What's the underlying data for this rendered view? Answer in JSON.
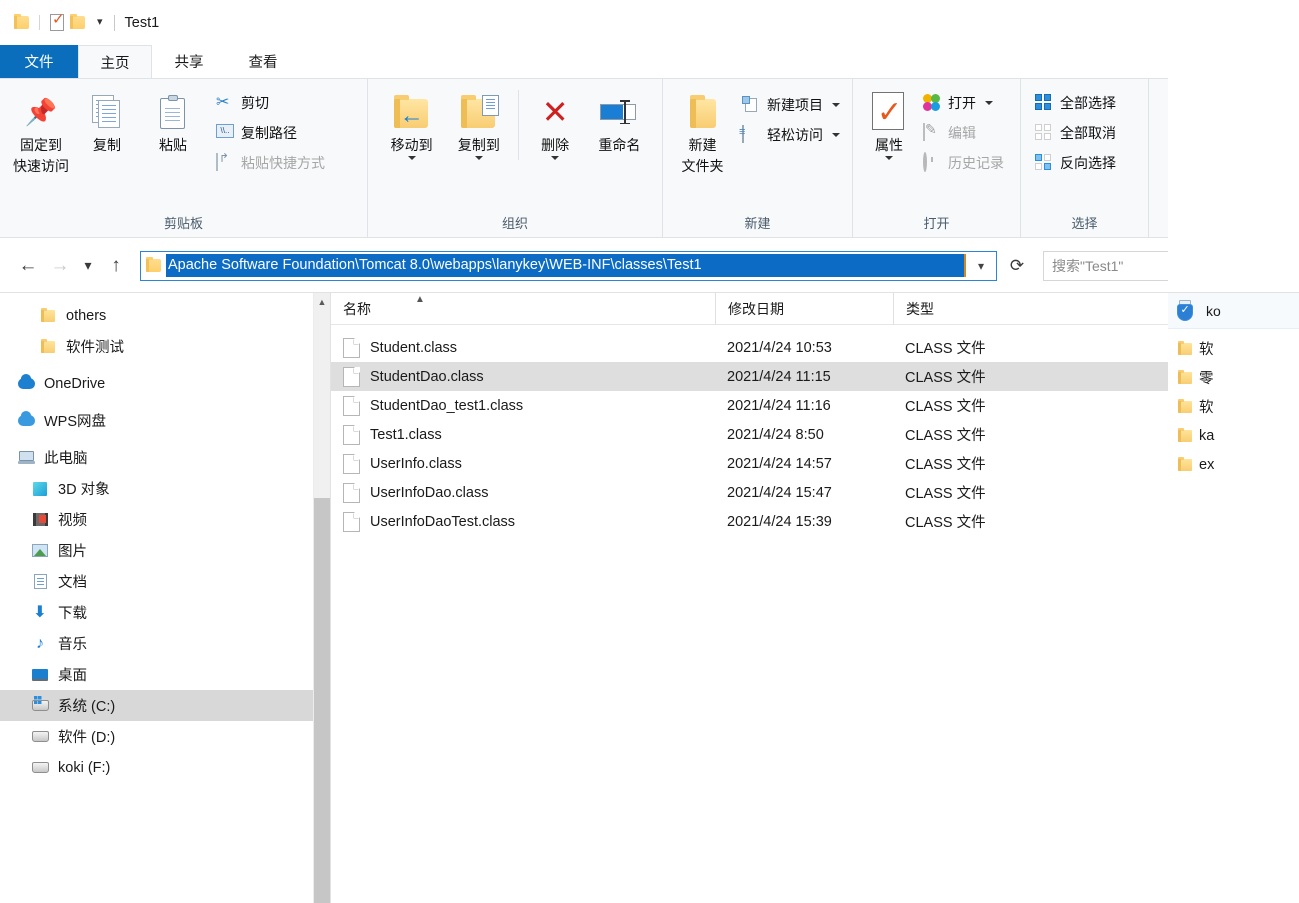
{
  "window": {
    "title": "Test1",
    "quick_access": {
      "folder_icon": "folder-icon",
      "properties_icon": "properties-checkmark-icon",
      "new_folder_icon": "new-folder-icon",
      "dropdown_icon": "chevron-down-icon"
    },
    "controls": {
      "minimize_label": "—"
    }
  },
  "ribbon": {
    "tabs": [
      {
        "id": "file",
        "label": "文件"
      },
      {
        "id": "home",
        "label": "主页"
      },
      {
        "id": "share",
        "label": "共享"
      },
      {
        "id": "view",
        "label": "查看"
      }
    ],
    "groups": [
      {
        "id": "clipboard",
        "title": "剪贴板",
        "big_buttons": [
          {
            "id": "pin-to-quick-access",
            "label_line1": "固定到",
            "label_line2": "快速访问",
            "icon": "pin-icon"
          },
          {
            "id": "copy",
            "label_line1": "复制",
            "label_line2": "",
            "icon": "copy-icon"
          },
          {
            "id": "paste",
            "label_line1": "粘贴",
            "label_line2": "",
            "icon": "clipboard-icon"
          }
        ],
        "small_buttons": [
          {
            "id": "cut",
            "label": "剪切",
            "icon": "scissors-icon",
            "dim": false
          },
          {
            "id": "copy-path",
            "label": "复制路径",
            "icon": "copy-path-icon",
            "dim": false
          },
          {
            "id": "paste-shortcut",
            "label": "粘贴快捷方式",
            "icon": "paste-shortcut-icon",
            "dim": true
          }
        ]
      },
      {
        "id": "organize",
        "title": "组织",
        "big_buttons": [
          {
            "id": "move-to",
            "label_line1": "移动到",
            "label_line2": "",
            "icon": "move-to-icon",
            "caret": true
          },
          {
            "id": "copy-to",
            "label_line1": "复制到",
            "label_line2": "",
            "icon": "copy-to-icon",
            "caret": true
          },
          {
            "id": "delete",
            "label_line1": "删除",
            "label_line2": "",
            "icon": "delete-x-icon",
            "caret": true
          },
          {
            "id": "rename",
            "label_line1": "重命名",
            "label_line2": "",
            "icon": "rename-icon",
            "caret": false
          }
        ]
      },
      {
        "id": "new",
        "title": "新建",
        "big_buttons": [
          {
            "id": "new-folder",
            "label_line1": "新建",
            "label_line2": "文件夹",
            "icon": "new-folder-icon"
          }
        ],
        "small_buttons": [
          {
            "id": "new-item",
            "label": "新建项目",
            "icon": "new-item-icon",
            "caret": true
          },
          {
            "id": "easy-access",
            "label": "轻松访问",
            "icon": "easy-access-icon",
            "caret": true
          }
        ]
      },
      {
        "id": "open",
        "title": "打开",
        "big_buttons": [
          {
            "id": "properties",
            "label_line1": "属性",
            "label_line2": "",
            "icon": "properties-icon",
            "caret": true
          }
        ],
        "small_buttons": [
          {
            "id": "open",
            "label": "打开",
            "icon": "open-clover-icon",
            "caret": true,
            "dim": false
          },
          {
            "id": "edit",
            "label": "编辑",
            "icon": "edit-icon",
            "dim": true
          },
          {
            "id": "history",
            "label": "历史记录",
            "icon": "history-icon",
            "dim": true
          }
        ]
      },
      {
        "id": "select",
        "title": "选择",
        "small_buttons": [
          {
            "id": "select-all",
            "label": "全部选择",
            "icon": "select-all-icon",
            "variant": "full"
          },
          {
            "id": "select-none",
            "label": "全部取消",
            "icon": "select-none-icon",
            "variant": "empty"
          },
          {
            "id": "invert-selection",
            "label": "反向选择",
            "icon": "invert-selection-icon",
            "variant": "mixed"
          }
        ]
      }
    ]
  },
  "address_bar": {
    "back_icon": "arrow-left-icon",
    "forward_icon": "arrow-right-icon",
    "recent_icon": "chevron-down-icon",
    "up_icon": "arrow-up-icon",
    "path_value": "Apache Software Foundation\\Tomcat 8.0\\webapps\\lanykey\\WEB-INF\\classes\\Test1",
    "dropdown_icon": "chevron-down-icon",
    "refresh_icon": "refresh-icon",
    "search_placeholder": "搜索\"Test1\""
  },
  "nav_pane": {
    "items": [
      {
        "id": "others",
        "label": "others",
        "icon": "folder-icon",
        "indent": 1,
        "selected": false
      },
      {
        "id": "software-test",
        "label": "软件测试",
        "icon": "folder-icon",
        "indent": 1,
        "selected": false
      },
      {
        "id": "onedrive",
        "label": "OneDrive",
        "icon": "cloud-icon",
        "indent": 0,
        "selected": false
      },
      {
        "id": "wps-cloud",
        "label": "WPS网盘",
        "icon": "wps-cloud-icon",
        "indent": 0,
        "selected": false
      },
      {
        "id": "this-pc",
        "label": "此电脑",
        "icon": "computer-icon",
        "indent": 0,
        "selected": false
      },
      {
        "id": "3d-objects",
        "label": "3D 对象",
        "icon": "cube-icon",
        "indent": 1,
        "selected": false
      },
      {
        "id": "videos",
        "label": "视频",
        "icon": "video-icon",
        "indent": 1,
        "selected": false
      },
      {
        "id": "pictures",
        "label": "图片",
        "icon": "picture-icon",
        "indent": 1,
        "selected": false
      },
      {
        "id": "documents",
        "label": "文档",
        "icon": "document-icon",
        "indent": 1,
        "selected": false
      },
      {
        "id": "downloads",
        "label": "下载",
        "icon": "download-icon",
        "indent": 1,
        "selected": false
      },
      {
        "id": "music",
        "label": "音乐",
        "icon": "music-icon",
        "indent": 1,
        "selected": false
      },
      {
        "id": "desktop",
        "label": "桌面",
        "icon": "desktop-icon",
        "indent": 1,
        "selected": false
      },
      {
        "id": "drive-c",
        "label": "系统 (C:)",
        "icon": "system-drive-icon",
        "indent": 1,
        "selected": true
      },
      {
        "id": "drive-d",
        "label": "软件 (D:)",
        "icon": "drive-icon",
        "indent": 1,
        "selected": false
      },
      {
        "id": "drive-f",
        "label": "koki (F:)",
        "icon": "drive-icon",
        "indent": 1,
        "selected": false
      }
    ]
  },
  "file_list": {
    "columns": [
      {
        "id": "name",
        "label": "名称",
        "sorted": true,
        "sort_icon": "caret-up-icon"
      },
      {
        "id": "date",
        "label": "修改日期",
        "sorted": false
      },
      {
        "id": "type",
        "label": "类型",
        "sorted": false
      }
    ],
    "rows": [
      {
        "name": "Student.class",
        "date": "2021/4/24 10:53",
        "type": "CLASS 文件",
        "selected": false
      },
      {
        "name": "StudentDao.class",
        "date": "2021/4/24 11:15",
        "type": "CLASS 文件",
        "selected": true
      },
      {
        "name": "StudentDao_test1.class",
        "date": "2021/4/24 11:16",
        "type": "CLASS 文件",
        "selected": false
      },
      {
        "name": "Test1.class",
        "date": "2021/4/24 8:50",
        "type": "CLASS 文件",
        "selected": false
      },
      {
        "name": "UserInfo.class",
        "date": "2021/4/24 14:57",
        "type": "CLASS 文件",
        "selected": false
      },
      {
        "name": "UserInfoDao.class",
        "date": "2021/4/24 15:47",
        "type": "CLASS 文件",
        "selected": false
      },
      {
        "name": "UserInfoDaoTest.class",
        "date": "2021/4/24 15:39",
        "type": "CLASS 文件",
        "selected": false
      }
    ],
    "expander_icon": "chevron-right-icon"
  },
  "background_window": {
    "header": {
      "icon": "usb-shield-icon",
      "label": "ko"
    },
    "items": [
      {
        "label": "软",
        "icon": "folder-icon"
      },
      {
        "label": "零",
        "icon": "folder-icon"
      },
      {
        "label": "软",
        "icon": "folder-icon"
      },
      {
        "label": "ka",
        "icon": "folder-icon"
      },
      {
        "label": "ex",
        "icon": "folder-icon"
      }
    ]
  },
  "colors": {
    "accent": "#0b6ebd",
    "selection": "#0c6bc4",
    "ribbon_bg": "#f7f9fb",
    "row_selected": "#dedede",
    "nav_selected": "#d8d8d8"
  }
}
